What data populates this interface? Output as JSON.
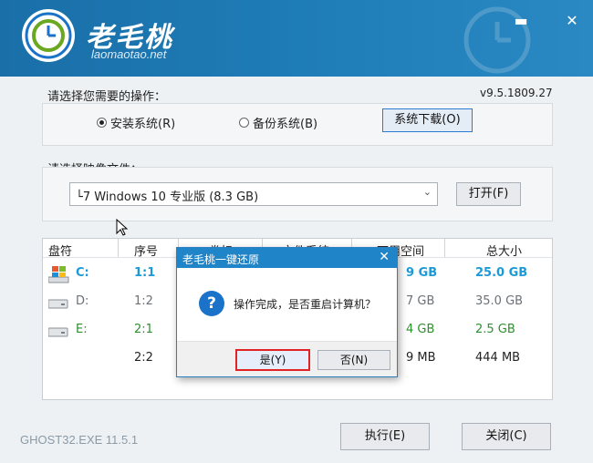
{
  "app": {
    "title": "老毛桃",
    "subtitle": "laomaotao.net",
    "version": "v9.5.1809.27"
  },
  "window": {
    "minimize": "▬",
    "close": "✕"
  },
  "operation": {
    "label": "请选择您需要的操作：",
    "install": "安装系统(R)",
    "backup": "备份系统(B)",
    "download": "系统下载(O)",
    "selected": "install"
  },
  "image": {
    "label": "请选择映像文件：",
    "value": "└7 Windows 10 专业版 (8.3 GB)",
    "open_button": "打开(F)"
  },
  "table": {
    "headers": [
      "盘符",
      "序号",
      "卷标",
      "文件系统",
      "可用空间",
      "总大小"
    ],
    "rows": [
      {
        "drive": "C:",
        "index": "1:1",
        "free": "9 GB",
        "total": "25.0 GB",
        "color": "#1b9ad6",
        "icon": "windows-drive"
      },
      {
        "drive": "D:",
        "index": "1:2",
        "free": "7 GB",
        "total": "35.0 GB",
        "color": "#6b7177",
        "icon": "disk-drive"
      },
      {
        "drive": "E:",
        "index": "2:1",
        "free": "4 GB",
        "total": "2.5 GB",
        "color": "#2d8f2d",
        "icon": "disk-drive"
      },
      {
        "drive": "",
        "index": "2:2",
        "free": "9 MB",
        "total": "444 MB",
        "color": "#222222",
        "icon": ""
      }
    ]
  },
  "footer": {
    "engine": "GHOST32.EXE 11.5.1",
    "execute": "执行(E)",
    "close": "关闭(C)"
  },
  "dialog": {
    "title": "老毛桃一键还原",
    "message": "操作完成，是否重启计算机？",
    "yes": "是(Y)",
    "no": "否(N)"
  }
}
